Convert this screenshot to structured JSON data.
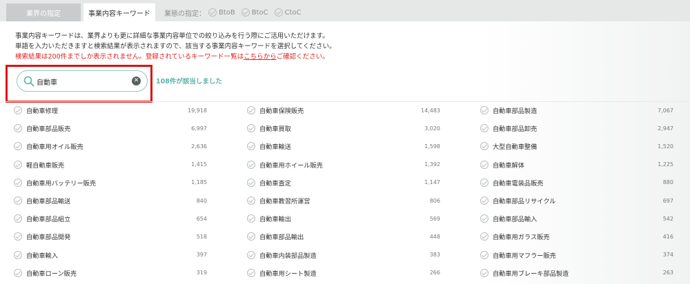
{
  "tabs": [
    {
      "label": "業界の指定",
      "active": false
    },
    {
      "label": "事業内容キーワード",
      "active": true
    }
  ],
  "business_type": {
    "label": "業態の指定：",
    "options": [
      "BtoB",
      "BtoC",
      "CtoC"
    ]
  },
  "description": {
    "line1": "事業内容キーワードは、業界よりも更に詳細な事業内容単位での絞り込みを行う際にご活用いただけます。",
    "line2": "単語を入力いただきますと検索結果が表示されますので、該当する事業内容キーワードを選択してください。",
    "warning_prefix": "検索結果は200件までしか表示されません。登録されているキーワード一覧は",
    "warning_link": "こちらから",
    "warning_suffix": "ご確認ください。"
  },
  "search": {
    "value": "自動車",
    "result_count": "108件が該当しました"
  },
  "colors": {
    "accent": "#5ab4a8",
    "highlight": "#dd1212",
    "warning": "#e02020"
  },
  "results": {
    "columns": [
      [
        {
          "name": "自動車修理",
          "count": "19,918"
        },
        {
          "name": "自動車部品販売",
          "count": "6,997"
        },
        {
          "name": "自動車用オイル販売",
          "count": "2,636"
        },
        {
          "name": "軽自動車販売",
          "count": "1,415"
        },
        {
          "name": "自動車用バッテリー販売",
          "count": "1,185"
        },
        {
          "name": "自動車部品輸送",
          "count": "840"
        },
        {
          "name": "自動車部品組立",
          "count": "654"
        },
        {
          "name": "自動車部品開発",
          "count": "518"
        },
        {
          "name": "自動車輸入",
          "count": "397"
        },
        {
          "name": "自動車ローン販売",
          "count": "319"
        }
      ],
      [
        {
          "name": "自動車保険販売",
          "count": "14,483"
        },
        {
          "name": "自動車買取",
          "count": "3,020"
        },
        {
          "name": "自動車輸送",
          "count": "1,598"
        },
        {
          "name": "自動車用ホイール販売",
          "count": "1,392"
        },
        {
          "name": "自動車査定",
          "count": "1,147"
        },
        {
          "name": "自動車教習所運営",
          "count": "806"
        },
        {
          "name": "自動車輸出",
          "count": "569"
        },
        {
          "name": "自動車部品輸出",
          "count": "448"
        },
        {
          "name": "自動車内装部品製造",
          "count": "383"
        },
        {
          "name": "自動車用シート製造",
          "count": "266"
        }
      ],
      [
        {
          "name": "自動車部品製造",
          "count": "7,067"
        },
        {
          "name": "自動車部品卸売",
          "count": "2,947"
        },
        {
          "name": "大型自動車整備",
          "count": "1,520"
        },
        {
          "name": "自動車解体",
          "count": "1,225"
        },
        {
          "name": "自動車電装品販売",
          "count": "880"
        },
        {
          "name": "自動車部品リサイクル",
          "count": "697"
        },
        {
          "name": "自動車部品輸入",
          "count": "542"
        },
        {
          "name": "自動車用ガラス販売",
          "count": "416"
        },
        {
          "name": "自動車用マフラー販売",
          "count": "374"
        },
        {
          "name": "自動車用ブレーキ部品製造",
          "count": "263"
        }
      ]
    ]
  }
}
